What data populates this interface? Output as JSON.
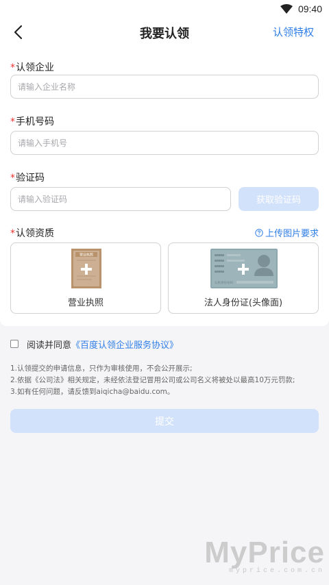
{
  "status_bar": {
    "time": "09:40"
  },
  "nav": {
    "title": "我要认领",
    "privilege_label": "认领特权"
  },
  "form": {
    "required_mark": "*",
    "company": {
      "label": "认领企业",
      "placeholder": "请输入企业名称"
    },
    "phone": {
      "label": "手机号码",
      "placeholder": "请输入手机号"
    },
    "code": {
      "label": "验证码",
      "placeholder": "请输入验证码",
      "button": "获取验证码"
    },
    "qualification": {
      "label": "认领资质",
      "upload_requirements": "上传图片要求",
      "license_caption": "营业执照",
      "license_img_text": "营业执照",
      "idcard_caption": "法人身份证(头像面)",
      "idcard_img_text": "公民身份号码"
    }
  },
  "agreement": {
    "prefix": "阅读并同意",
    "link": "《百度认领企业服务协议》"
  },
  "notes": [
    "1.认领提交的申请信息，只作为审核使用，不会公开展示;",
    "2.依据《公司法》相关规定，未经依法登记冒用公司或公司名义将被处以最高10万元罚款;",
    "3.如有任何问题，请反馈到aiqicha@baidu.com。"
  ],
  "submit_label": "提交",
  "watermark": {
    "big": "MyPrice",
    "small": "myprice.com.cn"
  },
  "colors": {
    "accent": "#2f7ee6",
    "disabled_button": "#d3e2fb",
    "required": "#e8352f"
  }
}
